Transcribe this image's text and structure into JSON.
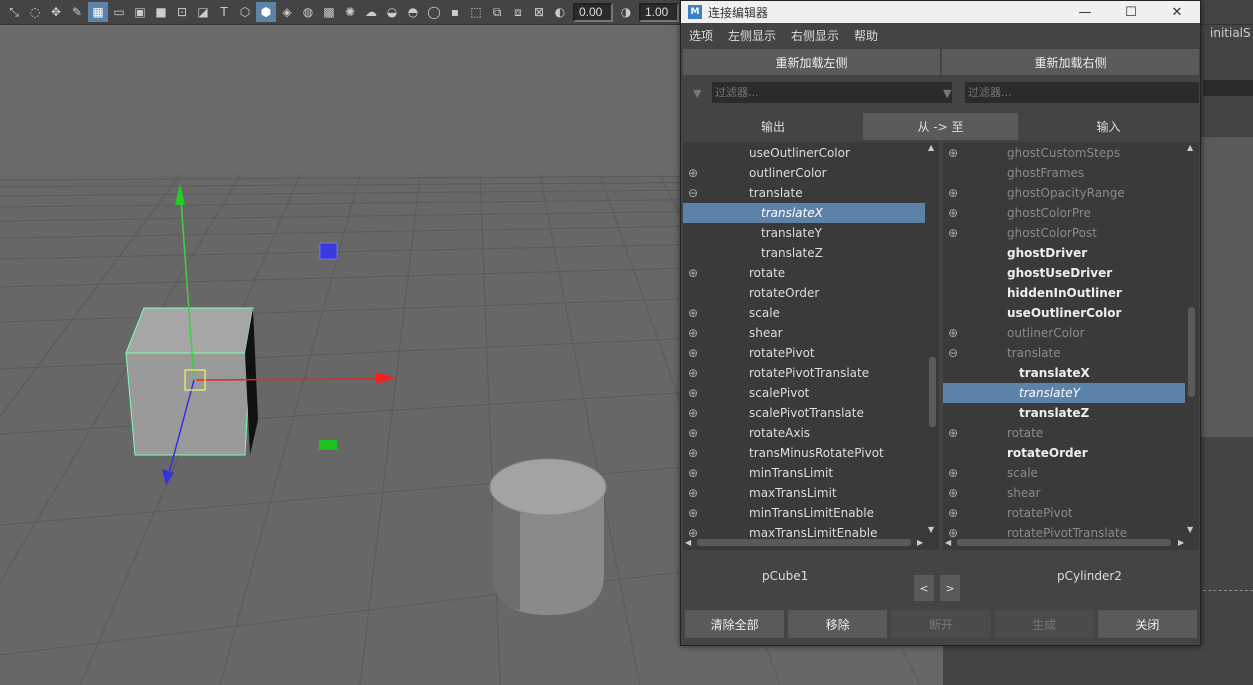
{
  "toolbar": {
    "value1": "0.00",
    "value2": "1.00"
  },
  "right_panel": {
    "title": "initialS"
  },
  "editor": {
    "title": "连接编辑器",
    "menu": [
      "选项",
      "左侧显示",
      "右侧显示",
      "帮助"
    ],
    "reload_left": "重新加载左侧",
    "reload_right": "重新加载右侧",
    "filter_placeholder": "过滤器...",
    "tab_output": "输出",
    "tab_from_to": "从 -> 至",
    "tab_input": "输入",
    "left_list": [
      {
        "label": "useOutlinerColor",
        "exp": "",
        "state": "normal",
        "indent": 0
      },
      {
        "label": "outlinerColor",
        "exp": "⊕",
        "state": "normal",
        "indent": 0
      },
      {
        "label": "translate",
        "exp": "⊖",
        "state": "normal",
        "indent": 0
      },
      {
        "label": "translateX",
        "exp": "",
        "state": "sel",
        "indent": 1
      },
      {
        "label": "translateY",
        "exp": "",
        "state": "normal",
        "indent": 1
      },
      {
        "label": "translateZ",
        "exp": "",
        "state": "normal",
        "indent": 1
      },
      {
        "label": "rotate",
        "exp": "⊕",
        "state": "normal",
        "indent": 0
      },
      {
        "label": "rotateOrder",
        "exp": "",
        "state": "normal",
        "indent": 0
      },
      {
        "label": "scale",
        "exp": "⊕",
        "state": "normal",
        "indent": 0
      },
      {
        "label": "shear",
        "exp": "⊕",
        "state": "normal",
        "indent": 0
      },
      {
        "label": "rotatePivot",
        "exp": "⊕",
        "state": "normal",
        "indent": 0
      },
      {
        "label": "rotatePivotTranslate",
        "exp": "⊕",
        "state": "normal",
        "indent": 0
      },
      {
        "label": "scalePivot",
        "exp": "⊕",
        "state": "normal",
        "indent": 0
      },
      {
        "label": "scalePivotTranslate",
        "exp": "⊕",
        "state": "normal",
        "indent": 0
      },
      {
        "label": "rotateAxis",
        "exp": "⊕",
        "state": "normal",
        "indent": 0
      },
      {
        "label": "transMinusRotatePivot",
        "exp": "⊕",
        "state": "normal",
        "indent": 0
      },
      {
        "label": "minTransLimit",
        "exp": "⊕",
        "state": "normal",
        "indent": 0
      },
      {
        "label": "maxTransLimit",
        "exp": "⊕",
        "state": "normal",
        "indent": 0
      },
      {
        "label": "minTransLimitEnable",
        "exp": "⊕",
        "state": "normal",
        "indent": 0
      },
      {
        "label": "maxTransLimitEnable",
        "exp": "⊕",
        "state": "normal",
        "indent": 0
      }
    ],
    "right_list": [
      {
        "label": "ghostCustomSteps",
        "exp": "⊕",
        "state": "dim",
        "indent": 0
      },
      {
        "label": "ghostFrames",
        "exp": "",
        "state": "dim",
        "indent": 0
      },
      {
        "label": "ghostOpacityRange",
        "exp": "⊕",
        "state": "dim",
        "indent": 0
      },
      {
        "label": "ghostColorPre",
        "exp": "⊕",
        "state": "dim",
        "indent": 0
      },
      {
        "label": "ghostColorPost",
        "exp": "⊕",
        "state": "dim",
        "indent": 0
      },
      {
        "label": "ghostDriver",
        "exp": "",
        "state": "bold",
        "indent": 0
      },
      {
        "label": "ghostUseDriver",
        "exp": "",
        "state": "bold",
        "indent": 0
      },
      {
        "label": "hiddenInOutliner",
        "exp": "",
        "state": "bold",
        "indent": 0
      },
      {
        "label": "useOutlinerColor",
        "exp": "",
        "state": "bold",
        "indent": 0
      },
      {
        "label": "outlinerColor",
        "exp": "⊕",
        "state": "dim",
        "indent": 0
      },
      {
        "label": "translate",
        "exp": "⊖",
        "state": "dim",
        "indent": 0
      },
      {
        "label": "translateX",
        "exp": "",
        "state": "bold",
        "indent": 1
      },
      {
        "label": "translateY",
        "exp": "",
        "state": "sel",
        "indent": 1
      },
      {
        "label": "translateZ",
        "exp": "",
        "state": "bold",
        "indent": 1
      },
      {
        "label": "rotate",
        "exp": "⊕",
        "state": "dim",
        "indent": 0
      },
      {
        "label": "rotateOrder",
        "exp": "",
        "state": "bold",
        "indent": 0
      },
      {
        "label": "scale",
        "exp": "⊕",
        "state": "dim",
        "indent": 0
      },
      {
        "label": "shear",
        "exp": "⊕",
        "state": "dim",
        "indent": 0
      },
      {
        "label": "rotatePivot",
        "exp": "⊕",
        "state": "dim",
        "indent": 0
      },
      {
        "label": "rotatePivotTranslate",
        "exp": "⊕",
        "state": "dim",
        "indent": 0
      }
    ],
    "left_node": "pCube1",
    "right_node": "pCylinder2",
    "nav_prev": "<",
    "nav_next": ">",
    "btn_clear_all": "清除全部",
    "btn_remove": "移除",
    "btn_break": "断开",
    "btn_make": "生成",
    "btn_close": "关闭"
  }
}
